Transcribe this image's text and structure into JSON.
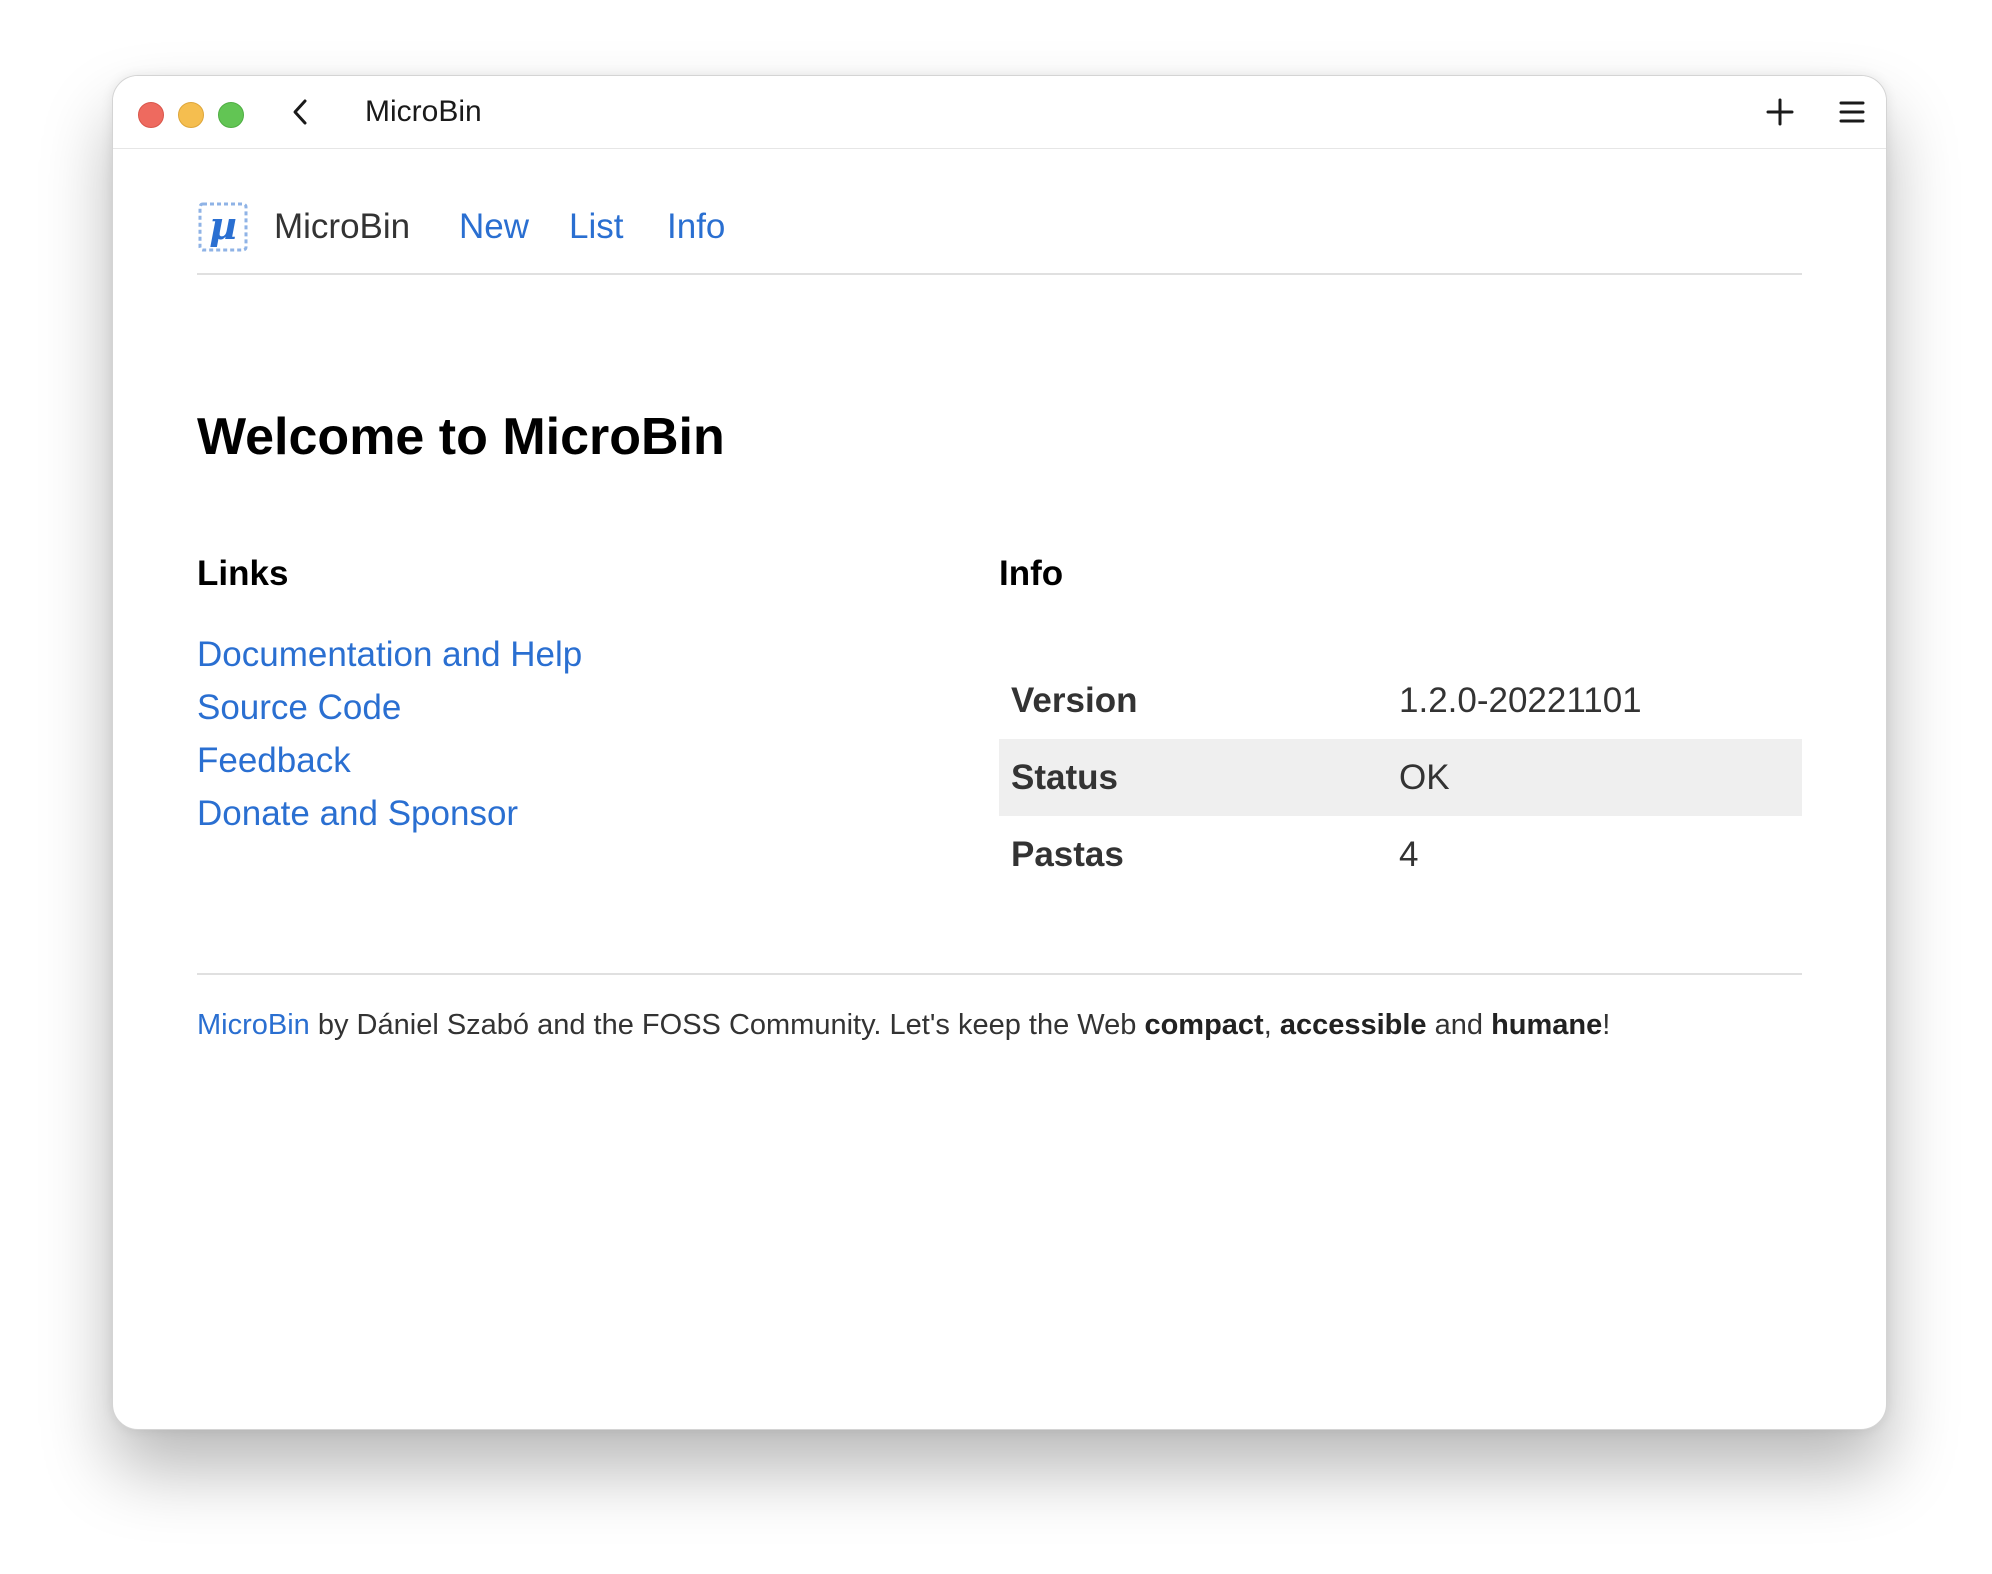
{
  "window": {
    "title": "MicroBin"
  },
  "nav": {
    "brand": "MicroBin",
    "logo_glyph": "µ",
    "logo_icon": "microbin-logo-icon",
    "links": [
      {
        "label": "New"
      },
      {
        "label": "List"
      },
      {
        "label": "Info"
      }
    ]
  },
  "page": {
    "heading": "Welcome to MicroBin"
  },
  "links_section": {
    "title": "Links",
    "items": [
      {
        "label": "Documentation and Help"
      },
      {
        "label": "Source Code"
      },
      {
        "label": "Feedback"
      },
      {
        "label": "Donate and Sponsor"
      }
    ]
  },
  "info_section": {
    "title": "Info",
    "rows": [
      {
        "key": "Version",
        "value": "1.2.0-20221101"
      },
      {
        "key": "Status",
        "value": "OK"
      },
      {
        "key": "Pastas",
        "value": "4"
      }
    ]
  },
  "footer": {
    "link": "MicroBin",
    "text_1": " by Dániel Szabó and the FOSS Community. Let's keep the Web ",
    "bold_1": "compact",
    "text_2": ", ",
    "bold_2": "accessible",
    "text_3": " and ",
    "bold_3": "humane",
    "text_4": "!"
  },
  "colors": {
    "link": "#2a6fd1",
    "text": "#333333",
    "shaded_row": "#efefef",
    "traffic_red": "#ee6a5f",
    "traffic_yellow": "#f5be4f",
    "traffic_green": "#62c554"
  }
}
